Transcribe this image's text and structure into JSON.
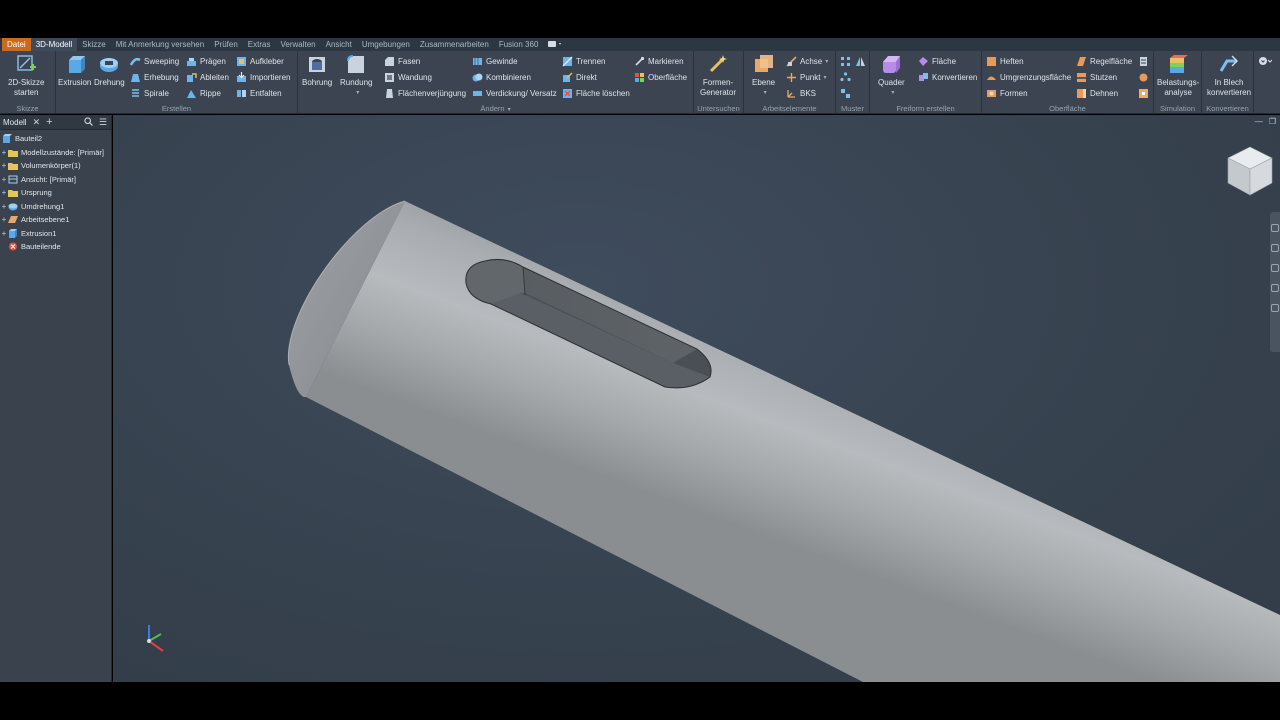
{
  "menu": {
    "tabs": [
      "Datei",
      "3D-Modell",
      "Skizze",
      "Mit Anmerkung versehen",
      "Prüfen",
      "Extras",
      "Verwalten",
      "Ansicht",
      "Umgebungen",
      "Zusammenarbeiten",
      "Fusion 360"
    ],
    "active": "3D-Modell"
  },
  "ribbon": {
    "skizze": {
      "label": "Skizze",
      "start_line1": "2D-Skizze",
      "start_line2": "starten"
    },
    "erstellen": {
      "label": "Erstellen",
      "extrusion": "Extrusion",
      "drehung": "Drehung",
      "col1": [
        "Sweeping",
        "Erhebung",
        "Spirale"
      ],
      "col2": [
        "Prägen",
        "Ableiten",
        "Rippe"
      ],
      "col3": [
        "Aufkleber",
        "Importieren",
        "Entfalten"
      ]
    },
    "aendern": {
      "label": "Ändern",
      "bohrung": "Bohrung",
      "rundung": "Rundung",
      "col1": [
        "Fasen",
        "Wandung",
        "Flächenverjüngung"
      ],
      "col2": [
        "Gewinde",
        "Kombinieren",
        "Verdickung/ Versatz"
      ],
      "col3": [
        "Trennen",
        "Direkt",
        "Fläche löschen"
      ],
      "col4": [
        "Markieren",
        "Oberfläche"
      ]
    },
    "untersuchen": {
      "label": "Untersuchen",
      "line1": "Formen-",
      "line2": "Generator"
    },
    "arbeitselemente": {
      "label": "Arbeitselemente",
      "ebene": "Ebene",
      "items": [
        "Achse",
        "Punkt",
        "BKS"
      ]
    },
    "muster": {
      "label": "Muster"
    },
    "freiform": {
      "label": "Freiform erstellen",
      "quader": "Quader",
      "items": [
        "Fläche",
        "Konvertieren"
      ]
    },
    "oberflaeche": {
      "label": "Oberfläche",
      "col1": [
        "Heften",
        "Umgrenzungsfläche",
        "Formen"
      ],
      "col2": [
        "Regelfläche",
        "Stutzen",
        "Dehnen"
      ]
    },
    "simulation": {
      "label": "Simulation",
      "line1": "Belastungs-",
      "line2": "analyse"
    },
    "konvertieren": {
      "label": "Konvertieren",
      "line1": "In Blech",
      "line2": "konvertieren"
    }
  },
  "browser": {
    "tab": "Modell",
    "root": "Bauteil2",
    "items": [
      {
        "label": "Modellzustände: [Primär]",
        "icon": "folder-icon"
      },
      {
        "label": "Volumenkörper(1)",
        "icon": "folder-icon"
      },
      {
        "label": "Ansicht: [Primär]",
        "icon": "view-icon"
      },
      {
        "label": "Ursprung",
        "icon": "folder-icon"
      },
      {
        "label": "Umdrehung1",
        "icon": "revolve-icon"
      },
      {
        "label": "Arbeitsebene1",
        "icon": "plane-icon"
      },
      {
        "label": "Extrusion1",
        "icon": "extrude-icon"
      },
      {
        "label": "Bauteilende",
        "icon": "end-of-part-icon"
      }
    ]
  },
  "colors": {
    "accent": "#c96a1e",
    "ribbon": "#3b4450",
    "viewport": "#37424f"
  }
}
